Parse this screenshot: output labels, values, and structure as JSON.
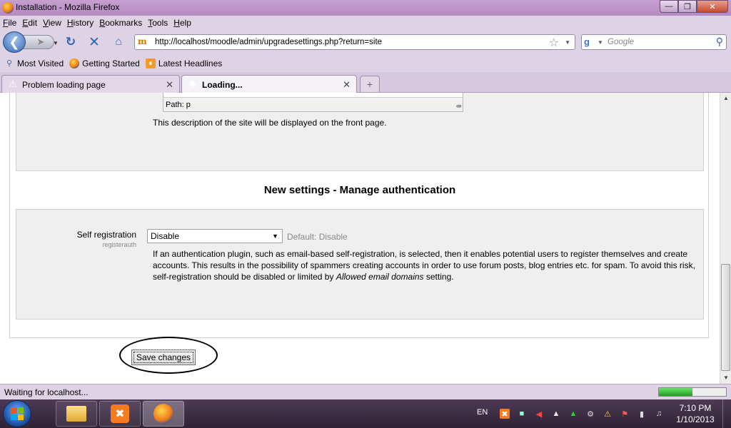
{
  "window": {
    "title": "Installation - Mozilla Firefox"
  },
  "menu": [
    "File",
    "Edit",
    "View",
    "History",
    "Bookmarks",
    "Tools",
    "Help"
  ],
  "nav": {
    "url": "http://localhost/moodle/admin/upgradesettings.php?return=site",
    "search_placeholder": "Google"
  },
  "bookmarks": [
    "Most Visited",
    "Getting Started",
    "Latest Headlines"
  ],
  "tabs": [
    {
      "label": "Problem loading page"
    },
    {
      "label": "Loading..."
    }
  ],
  "page": {
    "editor_path": "Path: p",
    "site_description": "This description of the site will be displayed on the front page.",
    "section_heading": "New settings - Manage authentication",
    "setting_label": "Self registration",
    "setting_key": "registerauth",
    "select_value": "Disable",
    "default_text": "Default: Disable",
    "help_text_1": "If an authentication plugin, such as email-based self-registration, is selected, then it enables potential users to register themselves and create accounts. This results in the possibility of spammers creating accounts in order to use forum posts, blog entries etc. for spam. To avoid this risk, self-registration should be disabled or limited by ",
    "help_text_italic": "Allowed email domains",
    "help_text_2": " setting.",
    "save_label": "Save changes"
  },
  "status": {
    "text": "Waiting for localhost...",
    "progress": 0.5
  },
  "taskbar": {
    "lang": "EN",
    "time": "7:10 PM",
    "date": "1/10/2013"
  }
}
